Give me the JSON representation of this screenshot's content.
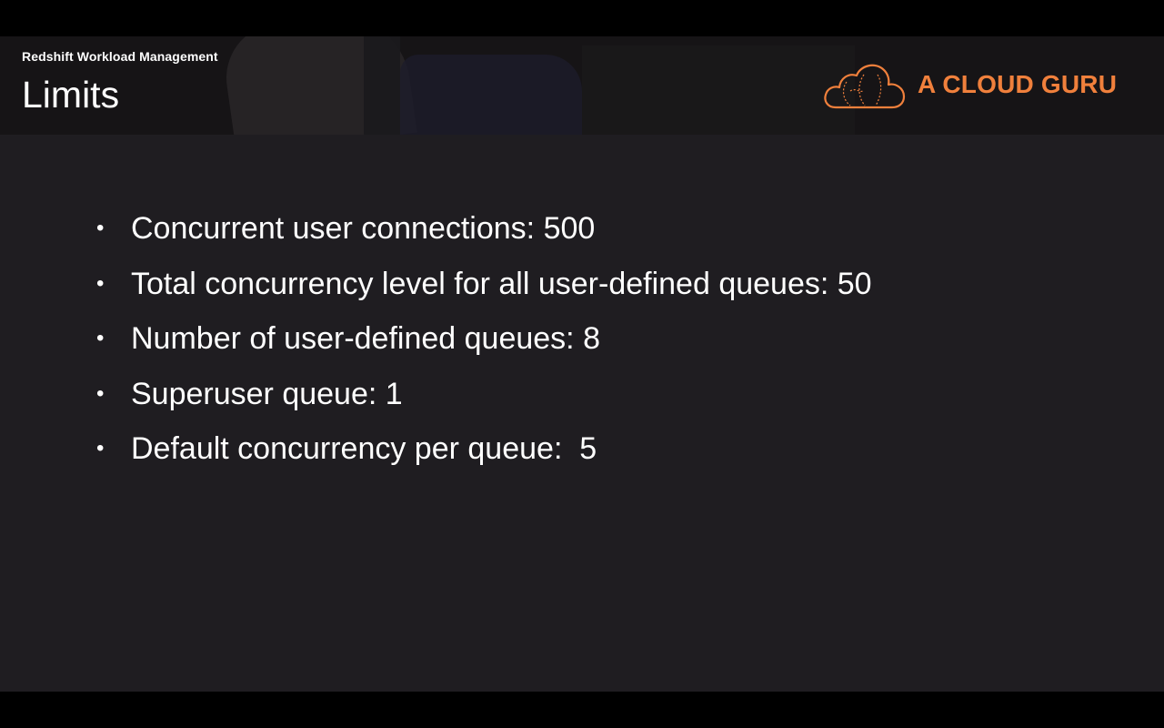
{
  "header": {
    "subtitle": "Redshift Workload Management",
    "title": "Limits"
  },
  "logo": {
    "text": "A CLOUD GURU",
    "icon": "cloud-logo-icon",
    "color": "#f0803c"
  },
  "bullets": [
    {
      "marker": "•",
      "text": "Concurrent user connections: 500"
    },
    {
      "marker": "•",
      "text": "Total concurrency level for all user-defined queues: 50"
    },
    {
      "marker": "•",
      "text": "Number of user-defined queues: 8"
    },
    {
      "marker": "•",
      "text": "Superuser queue: 1"
    },
    {
      "marker": "•",
      "text": "Default concurrency per queue:  5"
    }
  ],
  "colors": {
    "slide_background": "#1f1d21",
    "header_background": "#161416",
    "text": "#ffffff",
    "accent": "#f0803c"
  }
}
